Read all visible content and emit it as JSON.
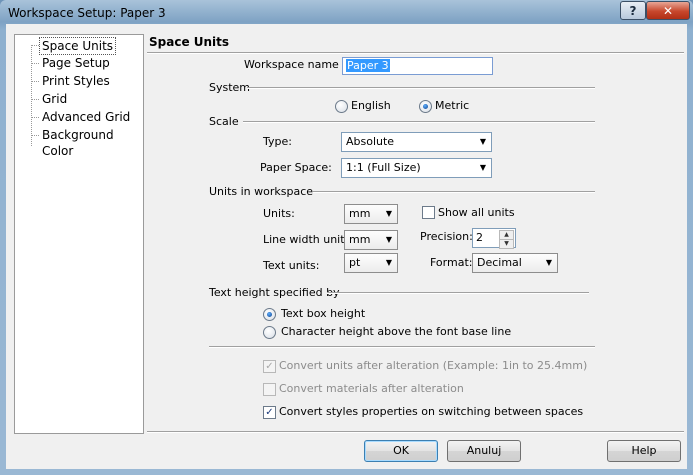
{
  "window": {
    "title": "Workspace Setup: Paper 3"
  },
  "titlebar": {
    "help_glyph": "?",
    "close_glyph": "✕"
  },
  "nav": {
    "items": [
      {
        "label": "Space Units",
        "selected": true
      },
      {
        "label": "Page Setup"
      },
      {
        "label": "Print Styles"
      },
      {
        "label": "Grid"
      },
      {
        "label": "Advanced Grid"
      },
      {
        "label": "Background Color"
      }
    ]
  },
  "panel": {
    "title": "Space Units",
    "workspace_name_label": "Workspace name",
    "workspace_name_value": "Paper 3",
    "system": {
      "label": "System",
      "english": "English",
      "metric": "Metric",
      "selected": "Metric"
    },
    "scale": {
      "label": "Scale",
      "type_label": "Type:",
      "type_value": "Absolute",
      "paper_space_label": "Paper Space:",
      "paper_space_value": "1:1 (Full Size)"
    },
    "units": {
      "label": "Units in workspace",
      "units_label": "Units:",
      "units_value": "mm",
      "line_width_label": "Line width units:",
      "line_width_value": "mm",
      "text_units_label": "Text units:",
      "text_units_value": "pt",
      "show_all_label": "Show all units",
      "show_all_checked": false,
      "precision_label": "Precision:",
      "precision_value": "2",
      "format_label": "Format:",
      "format_value": "Decimal"
    },
    "text_height": {
      "label": "Text height specified by",
      "option1": "Text box height",
      "option2": "Character height above the font base line",
      "selected": "Text box height"
    },
    "options": {
      "convert_units": "Convert units after alteration (Example: 1in to 25.4mm)",
      "convert_units_checked": true,
      "convert_materials": "Convert materials after alteration",
      "convert_materials_checked": false,
      "convert_styles": "Convert styles properties on switching between spaces",
      "convert_styles_checked": true
    }
  },
  "buttons": {
    "ok": "OK",
    "cancel": "Anuluj",
    "help": "Help"
  },
  "icons": {
    "dropdown": "chevron-down-icon",
    "spin_up": "spin-up-icon",
    "spin_down": "spin-down-icon",
    "check": "check-icon"
  }
}
